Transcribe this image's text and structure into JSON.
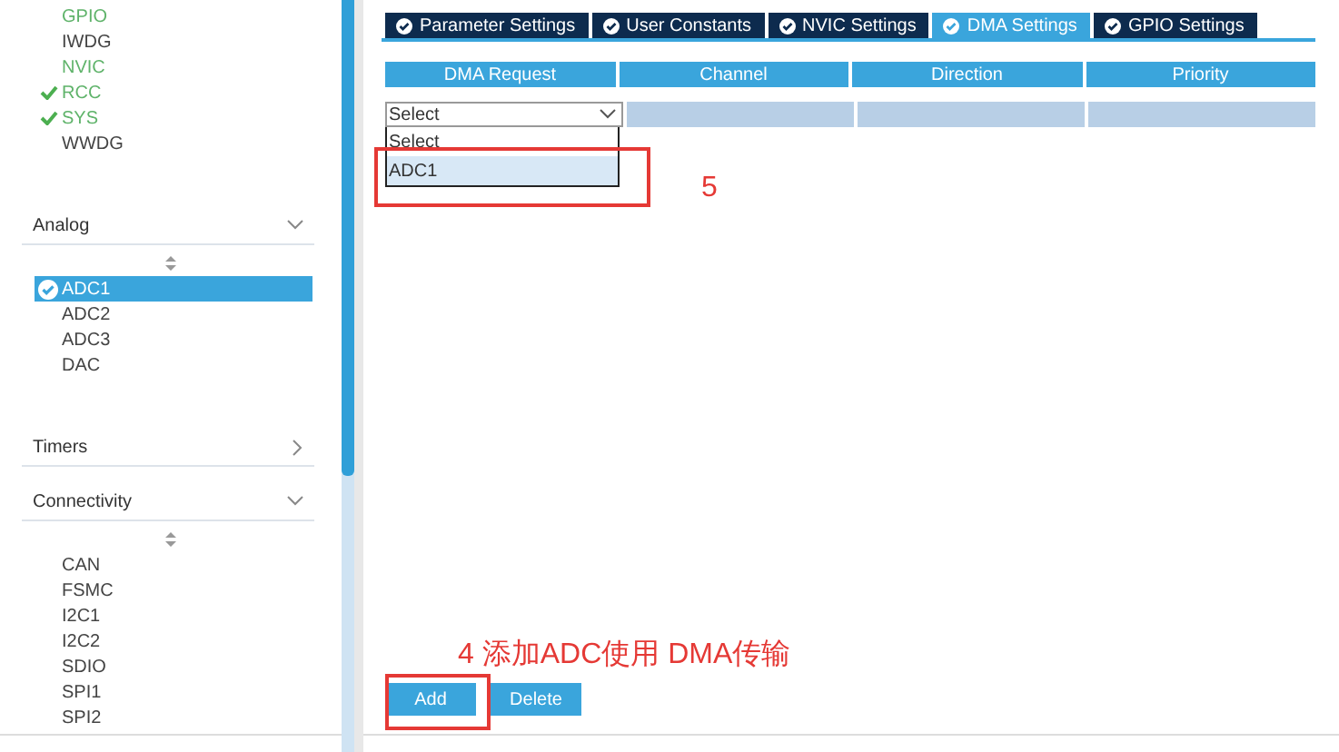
{
  "sidebar": {
    "top_items": [
      {
        "label": "GPIO",
        "enabled": true,
        "checked": false
      },
      {
        "label": "IWDG",
        "enabled": false,
        "checked": false
      },
      {
        "label": "NVIC",
        "enabled": true,
        "checked": false
      },
      {
        "label": "RCC",
        "enabled": true,
        "checked": true
      },
      {
        "label": "SYS",
        "enabled": true,
        "checked": true
      },
      {
        "label": "WWDG",
        "enabled": false,
        "checked": false
      }
    ],
    "categories": [
      {
        "label": "Analog",
        "expanded": true,
        "items": [
          {
            "label": "ADC1",
            "selected": true,
            "checked": true
          },
          {
            "label": "ADC2",
            "selected": false,
            "checked": false
          },
          {
            "label": "ADC3",
            "selected": false,
            "checked": false
          },
          {
            "label": "DAC",
            "selected": false,
            "checked": false
          }
        ]
      },
      {
        "label": "Timers",
        "expanded": false
      },
      {
        "label": "Connectivity",
        "expanded": true,
        "items": [
          {
            "label": "CAN",
            "selected": false,
            "checked": false
          },
          {
            "label": "FSMC",
            "selected": false,
            "checked": false
          },
          {
            "label": "I2C1",
            "selected": false,
            "checked": false
          },
          {
            "label": "I2C2",
            "selected": false,
            "checked": false
          },
          {
            "label": "SDIO",
            "selected": false,
            "checked": false
          },
          {
            "label": "SPI1",
            "selected": false,
            "checked": false
          },
          {
            "label": "SPI2",
            "selected": false,
            "checked": false
          }
        ]
      }
    ]
  },
  "tabs": [
    {
      "label": "Parameter Settings",
      "selected": false
    },
    {
      "label": "User Constants",
      "selected": false
    },
    {
      "label": "NVIC Settings",
      "selected": false
    },
    {
      "label": "DMA Settings",
      "selected": true
    },
    {
      "label": "GPIO Settings",
      "selected": false
    }
  ],
  "table": {
    "columns": [
      "DMA Request",
      "Channel",
      "Direction",
      "Priority"
    ],
    "row": {
      "request": "Select"
    },
    "dropdown_options": [
      {
        "label": "Select",
        "selected": false
      },
      {
        "label": "ADC1",
        "selected": true
      }
    ]
  },
  "buttons": [
    "Add",
    "Delete"
  ],
  "annotations": [
    {
      "label": "5"
    },
    {
      "label": "4 添加ADC使用 DMA传输"
    }
  ]
}
